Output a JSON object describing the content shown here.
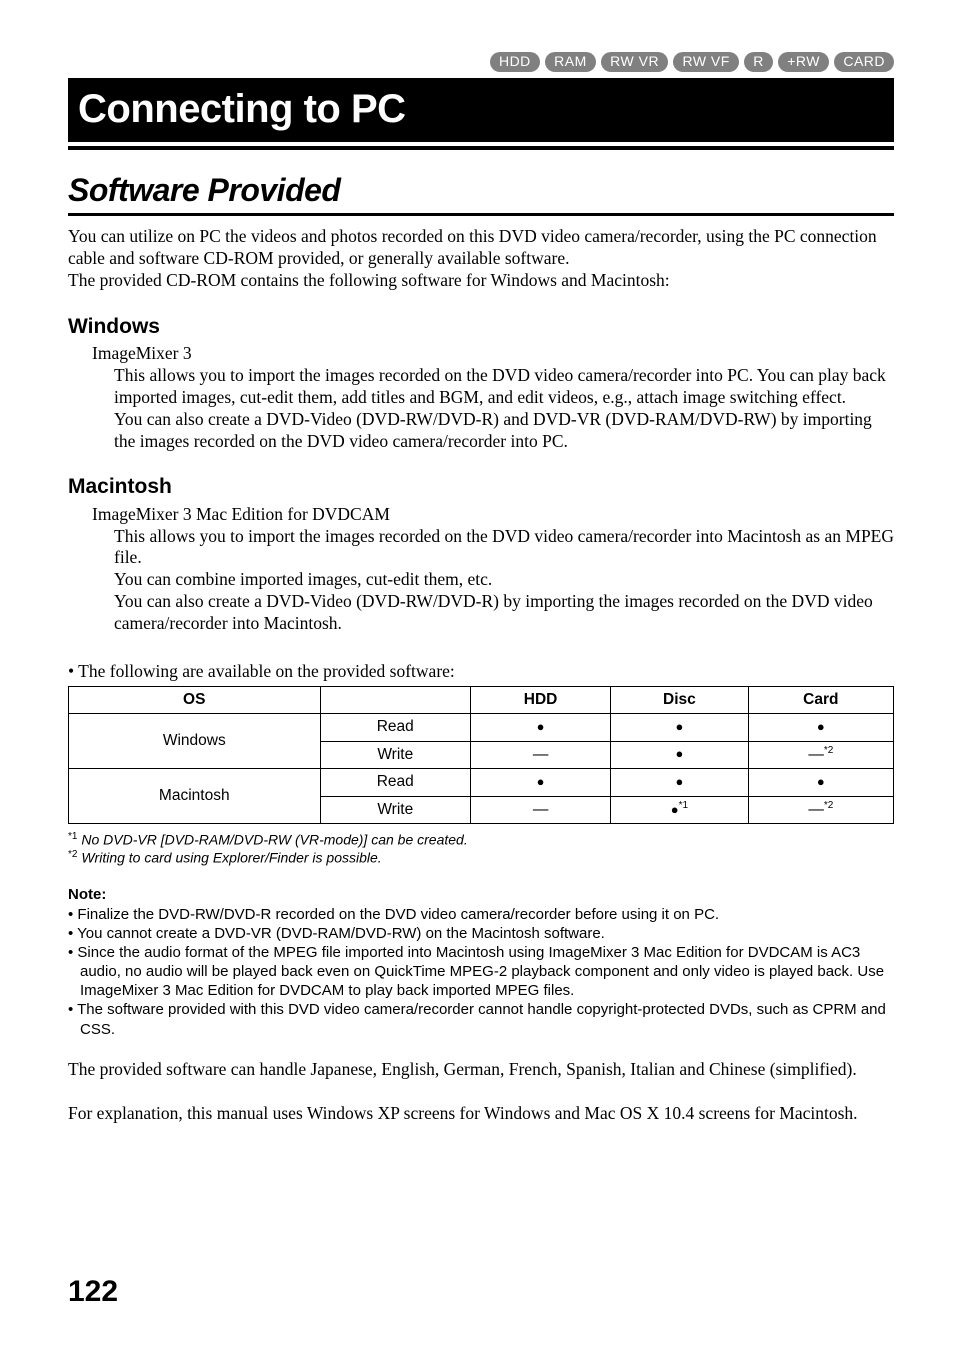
{
  "badges": [
    "HDD",
    "RAM",
    "RW VR",
    "RW VF",
    "R",
    "+RW",
    "CARD"
  ],
  "chapter_title": "Connecting to PC",
  "section_title": "Software Provided",
  "intro": {
    "p1": "You can utilize on PC the videos and photos recorded on this DVD video camera/recorder, using the PC connection cable and software CD-ROM provided, or generally available software.",
    "p2": "The provided CD-ROM contains the following software for Windows and Macintosh:"
  },
  "windows": {
    "heading": "Windows",
    "product": "ImageMixer 3",
    "para1": "This allows you to import the images recorded on the DVD video camera/recorder into PC. You can play back imported images, cut-edit them, add titles and BGM, and edit videos, e.g., attach image switching effect.",
    "para2": "You can also create a DVD-Video (DVD-RW/DVD-R) and DVD-VR (DVD-RAM/DVD-RW) by importing the images recorded on the DVD video camera/recorder into PC."
  },
  "mac": {
    "heading": "Macintosh",
    "product": "ImageMixer 3 Mac Edition for DVDCAM",
    "para1": "This allows you to import the images recorded on the DVD video camera/recorder into Macintosh as an MPEG file.",
    "para2": "You can combine imported images, cut-edit them, etc.",
    "para3": "You can also create a DVD-Video (DVD-RW/DVD-R) by importing the images recorded on the DVD video camera/recorder into Macintosh."
  },
  "table_intro": "•  The following are available on the provided software:",
  "table": {
    "headers": [
      "OS",
      "",
      "HDD",
      "Disc",
      "Card"
    ],
    "rows": [
      {
        "os": "Windows",
        "mode": "Read",
        "hdd": "●",
        "disc": "●",
        "card": "●"
      },
      {
        "os": "",
        "mode": "Write",
        "hdd": "—",
        "disc": "●",
        "card": "—",
        "card_sup": "*2"
      },
      {
        "os": "Macintosh",
        "mode": "Read",
        "hdd": "●",
        "disc": "●",
        "card": "●"
      },
      {
        "os": "",
        "mode": "Write",
        "hdd": "—",
        "disc": "●",
        "disc_sup": "*1",
        "card": "—",
        "card_sup": "*2"
      }
    ]
  },
  "footnotes": {
    "f1_sup": "*1",
    "f1": "No DVD-VR [DVD-RAM/DVD-RW (VR-mode)] can be created.",
    "f2_sup": "*2",
    "f2": "Writing to card using Explorer/Finder is possible."
  },
  "note": {
    "head": "Note:",
    "items": [
      "•  Finalize the DVD-RW/DVD-R recorded on the DVD video camera/recorder before using it on PC.",
      "•  You cannot create a DVD-VR (DVD-RAM/DVD-RW) on the Macintosh software.",
      "•  Since the audio format of the MPEG file imported into Macintosh using ImageMixer 3 Mac Edition for DVDCAM is AC3 audio, no audio will be played back even on QuickTime MPEG-2 playback component and only video is played back. Use ImageMixer 3 Mac Edition for DVDCAM to play back imported MPEG files.",
      "•  The software provided with this DVD video camera/recorder cannot handle copyright-protected DVDs, such as CPRM and CSS."
    ]
  },
  "closing1": "The provided software can handle Japanese, English, German, French, Spanish, Italian and Chinese (simplified).",
  "closing2": "For explanation, this manual uses Windows XP screens for Windows and Mac OS X 10.4 screens for Macintosh.",
  "page_number": "122"
}
